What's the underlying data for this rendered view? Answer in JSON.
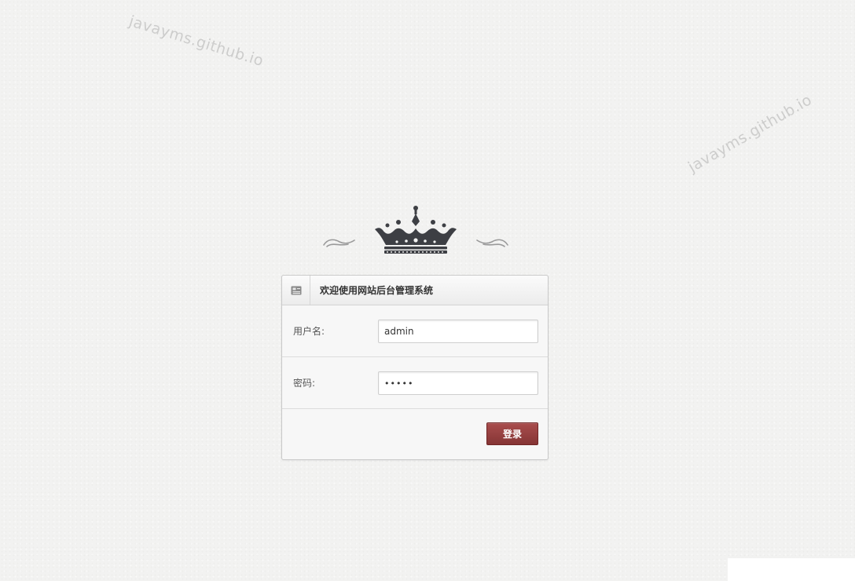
{
  "watermarks": [
    "javayms.github.io",
    "javayms.github.io"
  ],
  "login": {
    "title": "欢迎使用网站后台管理系统",
    "username_label": "用户名:",
    "username_value": "admin",
    "password_label": "密码:",
    "password_value": "•••••",
    "submit_label": "登录"
  },
  "icons": {
    "header_icon": "id-card-icon",
    "crown": "crown-icon",
    "flourish_left": "swirl-ornament-icon",
    "flourish_right": "swirl-ornament-icon"
  },
  "colors": {
    "background": "#f2f2f1",
    "crown": "#3d3f44",
    "button": "#973f3f",
    "panel_border": "#c9c9c9"
  }
}
